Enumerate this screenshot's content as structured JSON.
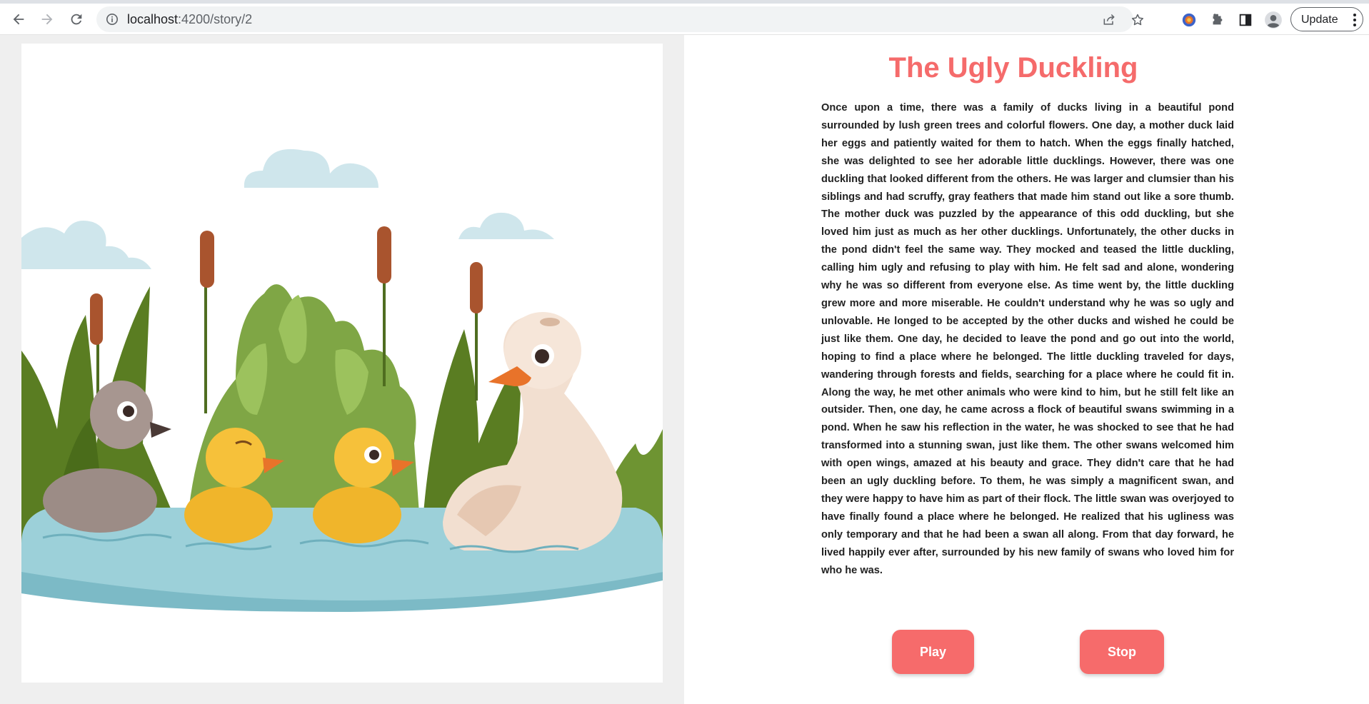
{
  "browser": {
    "url_host": "localhost",
    "url_rest": ":4200/story/2",
    "update_label": "Update"
  },
  "story": {
    "title": "The Ugly Duckling",
    "text": "Once upon a time, there was a family of ducks living in a beautiful pond surrounded by lush green trees and colorful flowers. One day, a mother duck laid her eggs and patiently waited for them to hatch. When the eggs finally hatched, she was delighted to see her adorable little ducklings. However, there was one duckling that looked different from the others. He was larger and clumsier than his siblings and had scruffy, gray feathers that made him stand out like a sore thumb. The mother duck was puzzled by the appearance of this odd duckling, but she loved him just as much as her other ducklings. Unfortunately, the other ducks in the pond didn't feel the same way. They mocked and teased the little duckling, calling him ugly and refusing to play with him. He felt sad and alone, wondering why he was so different from everyone else. As time went by, the little duckling grew more and more miserable. He couldn't understand why he was so ugly and unlovable. He longed to be accepted by the other ducks and wished he could be just like them. One day, he decided to leave the pond and go out into the world, hoping to find a place where he belonged. The little duckling traveled for days, wandering through forests and fields, searching for a place where he could fit in. Along the way, he met other animals who were kind to him, but he still felt like an outsider. Then, one day, he came across a flock of beautiful swans swimming in a pond. When he saw his reflection in the water, he was shocked to see that he had transformed into a stunning swan, just like them. The other swans welcomed him with open wings, amazed at his beauty and grace. They didn't care that he had been an ugly duckling before. To them, he was simply a magnificent swan, and they were happy to have him as part of their flock. The little swan was overjoyed to have finally found a place where he belonged. He realized that his ugliness was only temporary and that he had been a swan all along. From that day forward, he lived happily ever after, surrounded by his new family of swans who loved him for who he was.",
    "play_label": "Play",
    "stop_label": "Stop"
  },
  "colors": {
    "accent": "#f66b6b",
    "title": "#f56b6b",
    "text": "#222222",
    "left_pane_bg": "#efefef"
  },
  "icons": [
    "back-arrow-icon",
    "forward-arrow-icon",
    "reload-icon",
    "info-icon",
    "share-icon",
    "star-icon",
    "extension-circle-icon",
    "puzzle-icon",
    "side-panel-icon",
    "profile-icon",
    "kebab-menu-icon"
  ]
}
